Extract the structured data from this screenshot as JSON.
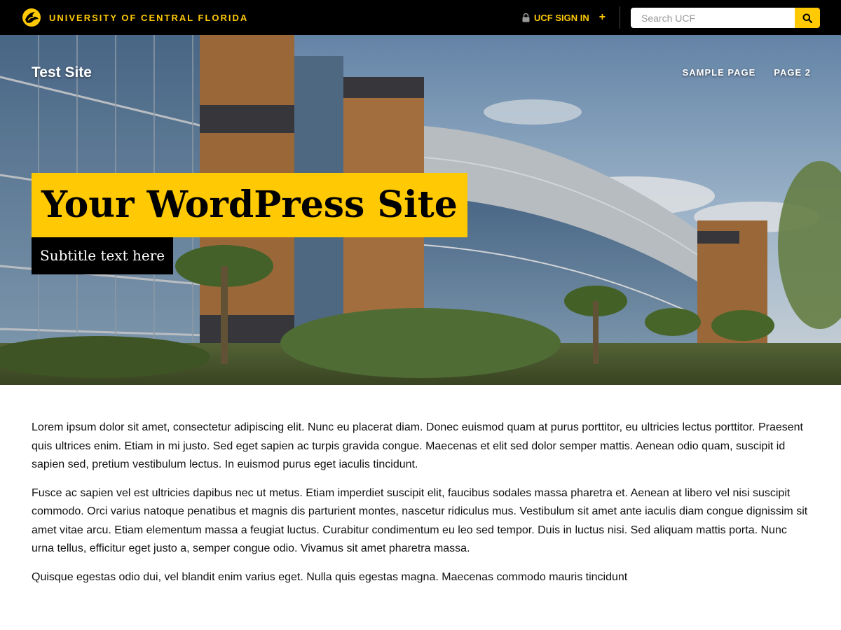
{
  "ucf_bar": {
    "university_name": "UNIVERSITY OF CENTRAL FLORIDA",
    "sign_in_label": "UCF SIGN IN",
    "sign_in_plus": "+",
    "search": {
      "placeholder": "Search UCF",
      "value": ""
    }
  },
  "site": {
    "title": "Test Site",
    "nav": [
      {
        "label": "SAMPLE PAGE"
      },
      {
        "label": "PAGE 2"
      }
    ]
  },
  "hero": {
    "title": "Your WordPress Site",
    "subtitle": "Subtitle text here"
  },
  "content": {
    "paragraphs": [
      "Lorem ipsum dolor sit amet, consectetur adipiscing elit. Nunc eu placerat diam. Donec euismod quam at purus porttitor, eu ultricies lectus porttitor. Praesent quis ultrices enim. Etiam in mi justo. Sed eget sapien ac turpis gravida congue. Maecenas et elit sed dolor semper mattis. Aenean odio quam, suscipit id sapien sed, pretium vestibulum lectus. In euismod purus eget iaculis tincidunt.",
      "Fusce ac sapien vel est ultricies dapibus nec ut metus. Etiam imperdiet suscipit elit, faucibus sodales massa pharetra et. Aenean at libero vel nisi suscipit commodo. Orci varius natoque penatibus et magnis dis parturient montes, nascetur ridiculus mus. Vestibulum sit amet ante iaculis diam congue dignissim sit amet vitae arcu. Etiam elementum massa a feugiat luctus. Curabitur condimentum eu leo sed tempor. Duis in luctus nisi. Sed aliquam mattis porta. Nunc urna tellus, efficitur eget justo a, semper congue odio. Vivamus sit amet pharetra massa.",
      "Quisque egestas odio dui, vel blandit enim varius eget. Nulla quis egestas magna. Maecenas commodo mauris tincidunt"
    ]
  },
  "colors": {
    "ucf_gold": "#ffc904",
    "ucf_black": "#000000"
  },
  "icons": {
    "logo": "ucf-pegasus-icon",
    "lock": "lock-icon",
    "search": "search-icon"
  }
}
